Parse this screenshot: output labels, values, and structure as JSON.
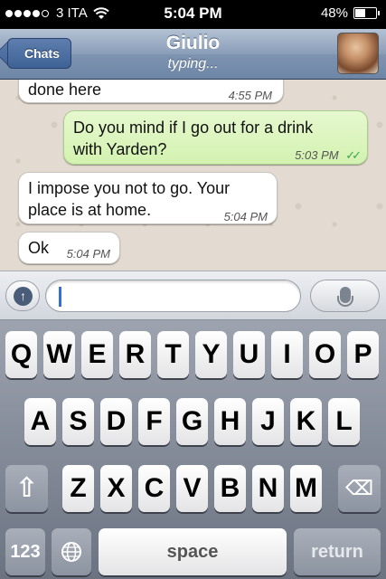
{
  "status_bar": {
    "signal_bars_filled": 4,
    "signal_bars_total": 5,
    "carrier": "3 ITA",
    "time": "5:04 PM",
    "battery": "48%",
    "battery_level": 0.48
  },
  "nav": {
    "back_label": "Chats",
    "contact_name": "Giulio",
    "status": "typing..."
  },
  "messages": [
    {
      "dir": "in",
      "text": "done here",
      "time": "4:55 PM"
    },
    {
      "dir": "out",
      "line1": "Do you mind if I go out for a drink",
      "line2": "with Yarden?",
      "time": "5:03 PM",
      "ticks": "✓✓"
    },
    {
      "dir": "in",
      "line1": "I impose you not to go. Your",
      "line2": "place is at home.",
      "time": "5:04 PM"
    },
    {
      "dir": "in",
      "text": "Ok",
      "time": "5:04 PM"
    }
  ],
  "input": {
    "attach_icon": "upload-arrow",
    "mic_icon": "microphone"
  },
  "keyboard": {
    "row1": [
      "Q",
      "W",
      "E",
      "R",
      "T",
      "Y",
      "U",
      "I",
      "O",
      "P"
    ],
    "row2": [
      "A",
      "S",
      "D",
      "F",
      "G",
      "H",
      "J",
      "K",
      "L"
    ],
    "row3": [
      "Z",
      "X",
      "C",
      "V",
      "B",
      "N",
      "M"
    ],
    "shift_icon": "⇧",
    "delete_icon": "⌫",
    "numbers_label": "123",
    "globe_icon": "globe",
    "space_label": "space",
    "return_label": "return"
  }
}
